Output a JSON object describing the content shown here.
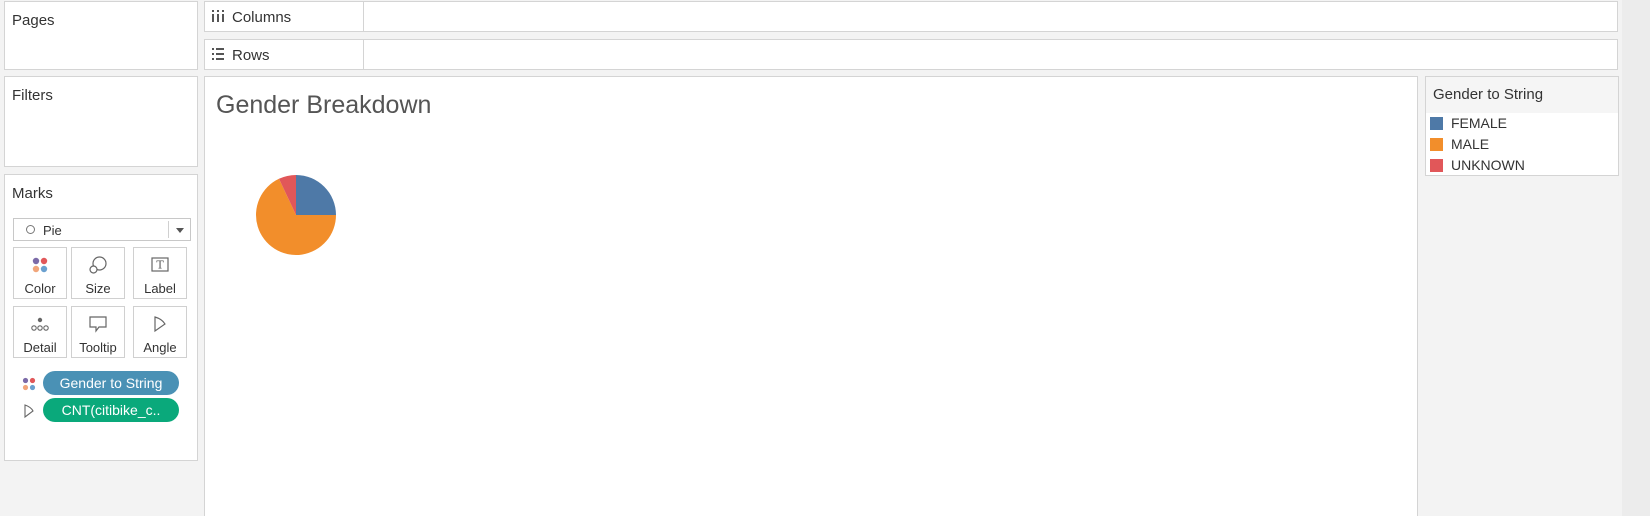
{
  "pages": {
    "title": "Pages"
  },
  "filters": {
    "title": "Filters"
  },
  "marks": {
    "title": "Marks",
    "mark_type": "Pie",
    "buttons": [
      {
        "label": "Color",
        "icon": "color-dots-icon"
      },
      {
        "label": "Size",
        "icon": "size-icon"
      },
      {
        "label": "Label",
        "icon": "label-t-icon"
      },
      {
        "label": "Detail",
        "icon": "detail-dots-icon"
      },
      {
        "label": "Tooltip",
        "icon": "tooltip-icon"
      },
      {
        "label": "Angle",
        "icon": "angle-icon"
      }
    ],
    "pills": [
      {
        "label": "Gender to String",
        "icon": "color-dots-icon",
        "color": "#4a91b5"
      },
      {
        "label": "CNT(citibike_c..",
        "icon": "angle-icon",
        "color": "#0aa97b"
      }
    ]
  },
  "shelves": {
    "columns": {
      "label": "Columns",
      "icon": "columns-icon"
    },
    "rows": {
      "label": "Rows",
      "icon": "rows-icon"
    }
  },
  "view": {
    "title": "Gender Breakdown"
  },
  "legend": {
    "title": "Gender to String",
    "items": [
      {
        "label": "FEMALE",
        "color": "#4e79a7"
      },
      {
        "label": "MALE",
        "color": "#f28e2b"
      },
      {
        "label": "UNKNOWN",
        "color": "#e15759"
      }
    ]
  },
  "chart_data": {
    "type": "pie",
    "title": "Gender Breakdown",
    "categories": [
      "FEMALE",
      "MALE",
      "UNKNOWN"
    ],
    "values": [
      25,
      68,
      7
    ],
    "colors": [
      "#4e79a7",
      "#f28e2b",
      "#e15759"
    ]
  }
}
